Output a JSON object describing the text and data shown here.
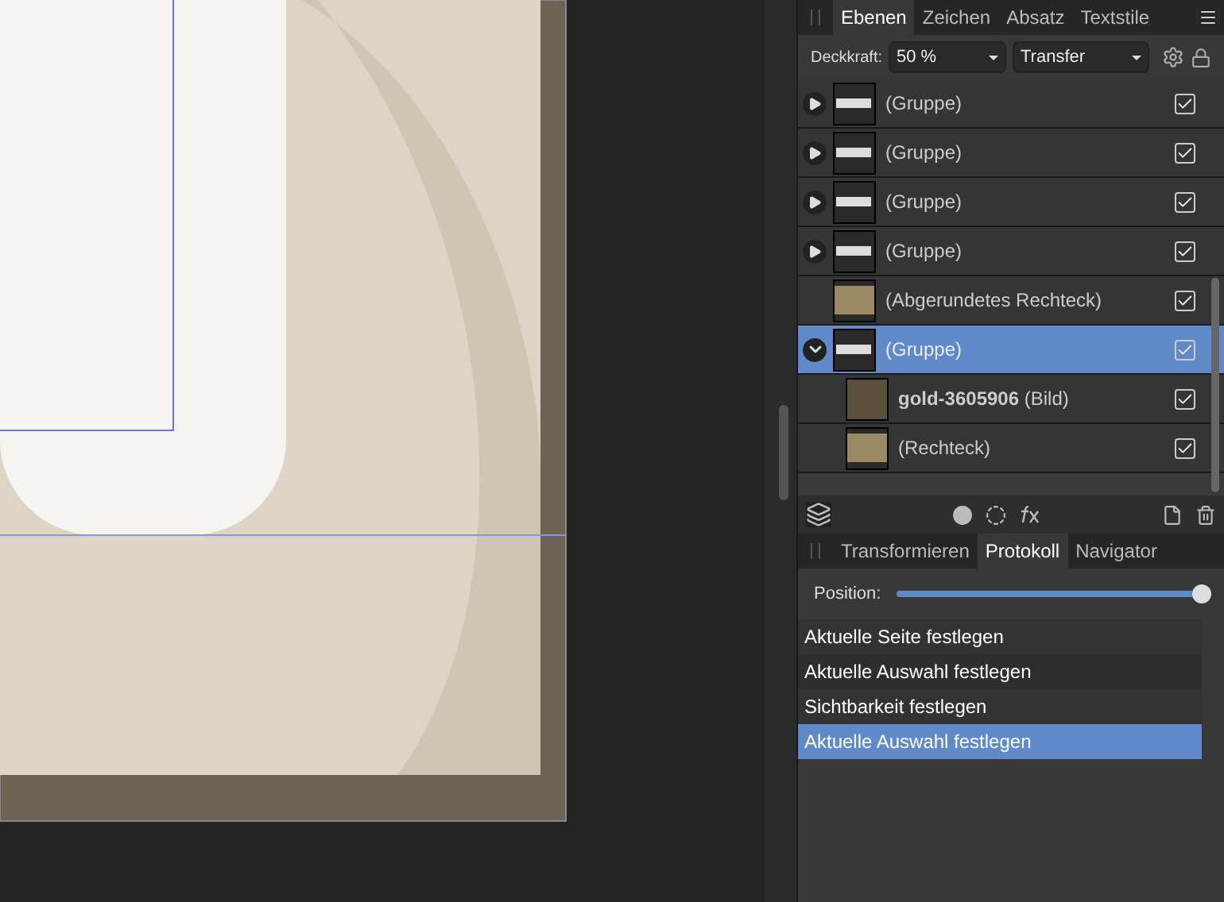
{
  "layers_panel": {
    "tabs": [
      {
        "label": "Ebenen",
        "selected": true
      },
      {
        "label": "Zeichen",
        "selected": false
      },
      {
        "label": "Absatz",
        "selected": false
      },
      {
        "label": "Textstile",
        "selected": false
      }
    ],
    "opacity_label": "Deckkraft:",
    "opacity_value": "50 %",
    "blend_mode": "Transfer",
    "layers": [
      {
        "kind": "group",
        "name": "(Gruppe)",
        "expanded": false,
        "selected": false,
        "visible": true
      },
      {
        "kind": "group",
        "name": "(Gruppe)",
        "expanded": false,
        "selected": false,
        "visible": true
      },
      {
        "kind": "group",
        "name": "(Gruppe)",
        "expanded": false,
        "selected": false,
        "visible": true
      },
      {
        "kind": "group",
        "name": "(Gruppe)",
        "expanded": false,
        "selected": false,
        "visible": true
      },
      {
        "kind": "shape",
        "name": "(Abgerundetes Rechteck)",
        "selected": false,
        "visible": true
      },
      {
        "kind": "group",
        "name": "(Gruppe)",
        "expanded": true,
        "selected": true,
        "visible": true,
        "children": [
          {
            "kind": "image",
            "name": "**gold-3605906** (Bild)",
            "selected": false,
            "visible": true
          },
          {
            "kind": "shape",
            "name": "(Rechteck)",
            "selected": false,
            "visible": true
          }
        ]
      }
    ]
  },
  "history_panel": {
    "tabs": [
      {
        "label": "Transformieren",
        "selected": false
      },
      {
        "label": "Protokoll",
        "selected": true
      },
      {
        "label": "Navigator",
        "selected": false
      }
    ],
    "position_label": "Position:",
    "position": {
      "level": 1
    },
    "items": [
      {
        "label": "Aktuelle Seite festlegen",
        "selected": false
      },
      {
        "label": "Aktuelle Auswahl festlegen",
        "selected": false
      },
      {
        "label": "Sichtbarkeit festlegen",
        "selected": false
      },
      {
        "label": "Aktuelle Auswahl festlegen",
        "selected": true
      }
    ]
  }
}
